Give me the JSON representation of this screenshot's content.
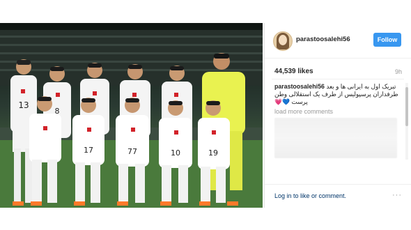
{
  "post": {
    "username": "parastoosalehi56",
    "follow_label": "Follow",
    "likes": "44,539 likes",
    "time": "9h",
    "caption_user": "parastoosalehi56",
    "caption_line1": "تبریک اول به ایرانی ها و بعد",
    "caption_line2": "طرفداران پرسپولیس از طرف یک استقلالی وطن",
    "caption_line3": "پرست",
    "caption_emoji": "💗💙",
    "load_more": "load more comments",
    "login_link": "Log in",
    "login_rest": " to like or comment.",
    "more_label": "···"
  },
  "photo": {
    "jersey_numbers_back": [
      "13",
      "8",
      "",
      "",
      "",
      ""
    ],
    "jersey_numbers_front": [
      "",
      "17",
      "77",
      "10",
      "19"
    ],
    "keeper_jersey": "#e9f250",
    "team_kit": "#ffffff",
    "accent": "#d2232a"
  }
}
